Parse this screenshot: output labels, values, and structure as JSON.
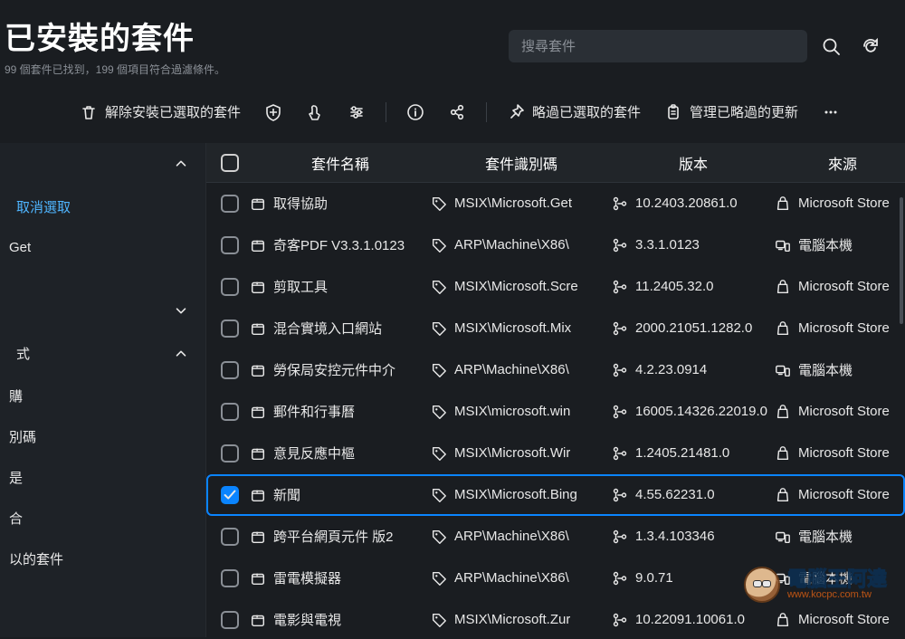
{
  "header": {
    "title": "已安裝的套件",
    "subtitle": "99 個套件已找到，199 個項目符合過濾條件。",
    "search_placeholder": "搜尋套件"
  },
  "toolbar": {
    "uninstall": "解除安裝已選取的套件",
    "skip": "略過已選取的套件",
    "manage_skipped": "管理已略過的更新"
  },
  "sidebar": {
    "deselect": "取消選取",
    "item_get": "Get",
    "group_style": "式",
    "items": [
      "購",
      "別碼",
      "是",
      "合",
      "以的套件"
    ]
  },
  "table": {
    "headers": {
      "name": "套件名稱",
      "id": "套件識別碼",
      "version": "版本",
      "source": "來源"
    },
    "rows": [
      {
        "checked": false,
        "name": "取得協助",
        "id": "MSIX\\Microsoft.Get",
        "version": "10.2403.20861.0",
        "source": "Microsoft Store",
        "source_icon": "bag"
      },
      {
        "checked": false,
        "name": "奇客PDF V3.3.1.0123",
        "id": "ARP\\Machine\\X86\\",
        "version": "3.3.1.0123",
        "source": "電腦本機",
        "source_icon": "pc"
      },
      {
        "checked": false,
        "name": "剪取工具",
        "id": "MSIX\\Microsoft.Scre",
        "version": "11.2405.32.0",
        "source": "Microsoft Store",
        "source_icon": "bag"
      },
      {
        "checked": false,
        "name": "混合實境入口網站",
        "id": "MSIX\\Microsoft.Mix",
        "version": "2000.21051.1282.0",
        "source": "Microsoft Store",
        "source_icon": "bag"
      },
      {
        "checked": false,
        "name": "勞保局安控元件中介",
        "id": "ARP\\Machine\\X86\\",
        "version": "4.2.23.0914",
        "source": "電腦本機",
        "source_icon": "pc"
      },
      {
        "checked": false,
        "name": "郵件和行事曆",
        "id": "MSIX\\microsoft.win",
        "version": "16005.14326.22019.0",
        "source": "Microsoft Store",
        "source_icon": "bag"
      },
      {
        "checked": false,
        "name": "意見反應中樞",
        "id": "MSIX\\Microsoft.Wir",
        "version": "1.2405.21481.0",
        "source": "Microsoft Store",
        "source_icon": "bag"
      },
      {
        "checked": true,
        "name": "新聞",
        "id": "MSIX\\Microsoft.Bing",
        "version": "4.55.62231.0",
        "source": "Microsoft Store",
        "source_icon": "bag"
      },
      {
        "checked": false,
        "name": "跨平台網頁元件 版2",
        "id": "ARP\\Machine\\X86\\",
        "version": "1.3.4.103346",
        "source": "電腦本機",
        "source_icon": "pc"
      },
      {
        "checked": false,
        "name": "雷電模擬器",
        "id": "ARP\\Machine\\X86\\",
        "version": "9.0.71",
        "source": "電腦本機",
        "source_icon": "pc"
      },
      {
        "checked": false,
        "name": "電影與電視",
        "id": "MSIX\\Microsoft.Zur",
        "version": "10.22091.10061.0",
        "source": "Microsoft Store",
        "source_icon": "bag"
      }
    ]
  },
  "watermark": {
    "text": "電腦王阿達",
    "url": "www.kocpc.com.tw"
  }
}
